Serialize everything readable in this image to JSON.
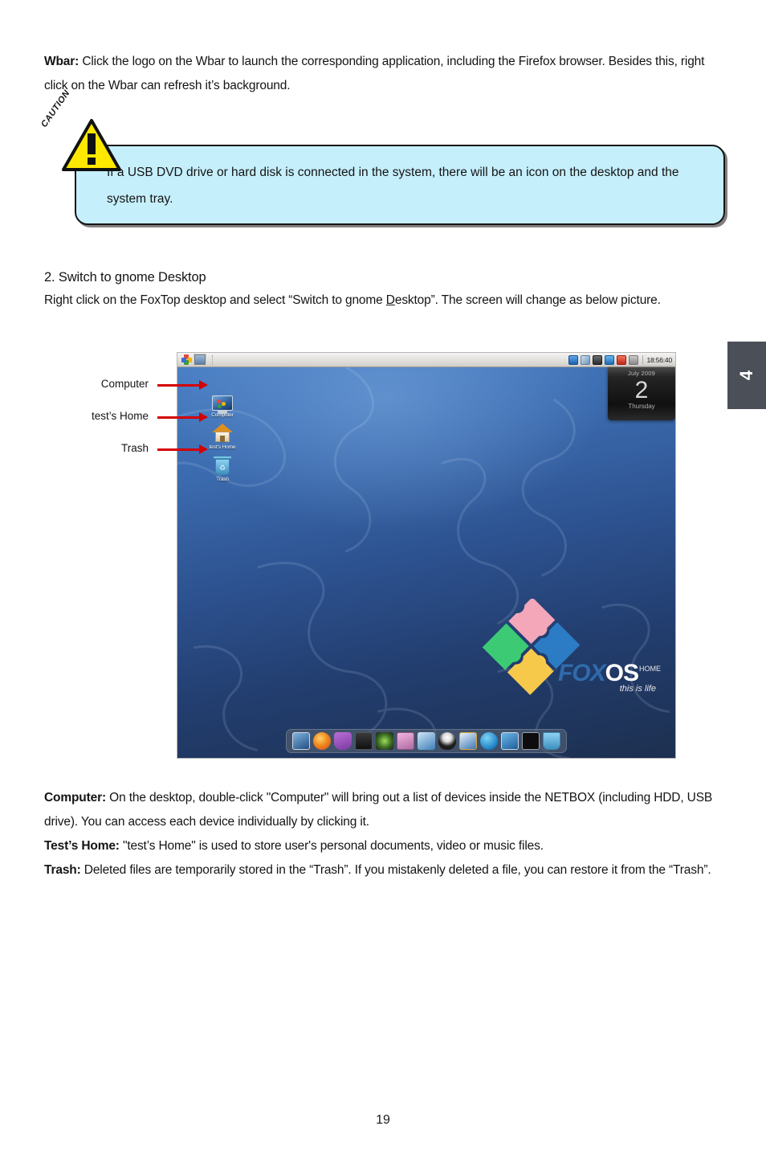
{
  "wbar": {
    "label": "Wbar:",
    "text": " Click the logo on the Wbar to launch the corresponding application, including the Firefox browser. Besides this, right click on the Wbar can refresh it’s background."
  },
  "caution": {
    "word": "CAUTION",
    "icon": "warning-triangle-icon",
    "text": "If a USB DVD drive or hard disk is connected in the system, there will be an icon on the desktop and the system tray.",
    "box_color": "#c6effc",
    "triangle_color": "#ffe800"
  },
  "section2": {
    "heading": "2. Switch to gnome Desktop",
    "body_before": "Right click on the FoxTop desktop and  select “Switch to gnome ",
    "body_underline": "D",
    "body_after": "esktop”. The screen will change as below picture."
  },
  "chapter_tab": {
    "label": "4",
    "color": "#4b4f58"
  },
  "screenshot": {
    "panel": {
      "menu_icon": "puzzle-menu-icon",
      "window_list_icon": "window-list-icon",
      "tray_icons": [
        "info-icon",
        "network-icon",
        "devices-icon",
        "update-icon",
        "power-icon",
        "volume-icon"
      ],
      "clock": "18:56:40"
    },
    "desktop_icons": [
      {
        "name": "Computer",
        "icon": "computer-icon"
      },
      {
        "name": "test’s Home",
        "icon": "home-folder-icon"
      },
      {
        "name": "Trash",
        "icon": "trash-icon"
      }
    ],
    "calendar": {
      "month": "July 2009",
      "day": "2",
      "weekday": "Thursday"
    },
    "logo": {
      "fox": "FOX",
      "os": "OS",
      "home": "HOME",
      "tm": "™",
      "tagline": "this is life",
      "puzzle_colors": [
        "#2b7cc4",
        "#f4a7b9",
        "#3ccb74",
        "#f7c94b"
      ]
    },
    "dock_icons": [
      "computer-dock-icon",
      "firefox-icon",
      "mail-icon",
      "video-icon",
      "camera-icon",
      "media-player-icon",
      "archive-icon",
      "tux-icon",
      "paint-icon",
      "globe-icon",
      "display-icon",
      "terminal-icon",
      "trash-dock-icon"
    ],
    "wallpaper_colors": {
      "top": "#4a7fc4",
      "bottom": "#1d3050"
    }
  },
  "annotations": [
    {
      "label": "Computer"
    },
    {
      "label": "test’s Home"
    },
    {
      "label": "Trash"
    }
  ],
  "bottom": {
    "computer_label": "Computer:",
    "computer_text": " On the desktop, double-click \"Computer\" will bring out a list of devices inside the NETBOX (including HDD, USB drive). You can access each device individually by clicking it.",
    "home_label": "Test’s Home:",
    "home_text": "  \"test’s Home\" is used to store user's personal documents, video or music files.",
    "trash_label": "Trash:",
    "trash_text": " Deleted files are temporarily stored in the “Trash”. If you mistakenly deleted a file, you can restore it from the “Trash”."
  },
  "page_number": "19"
}
